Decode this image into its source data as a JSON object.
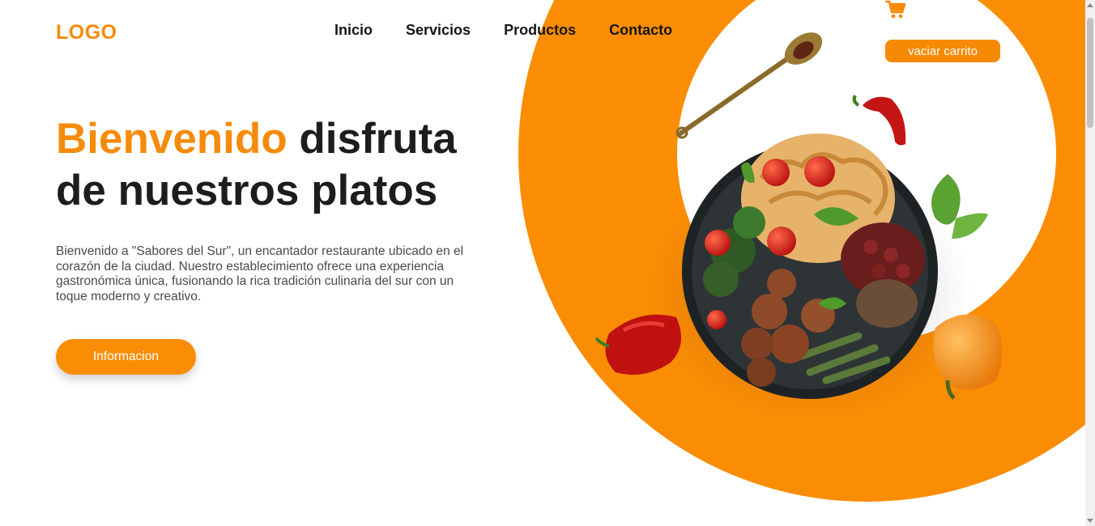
{
  "header": {
    "logo": "LOGO",
    "nav": [
      "Inicio",
      "Servicios",
      "Productos",
      "Contacto"
    ],
    "cart_icon": "shopping-cart-icon",
    "empty_cart_label": "vaciar carrito"
  },
  "hero": {
    "title_accent": "Bienvenido",
    "title_rest": " disfruta de nuestros platos",
    "description": "Bienvenido a \"Sabores del Sur\", un encantador restaurante ubicado en el corazón de la ciudad. Nuestro establecimiento ofrece una experiencia gastronómica única, fusionando la rica tradición culinaria del sur con un toque moderno y creativo.",
    "button_label": "Informacion"
  },
  "colors": {
    "accent": "#fb8d05",
    "text": "#1d1d1d"
  }
}
